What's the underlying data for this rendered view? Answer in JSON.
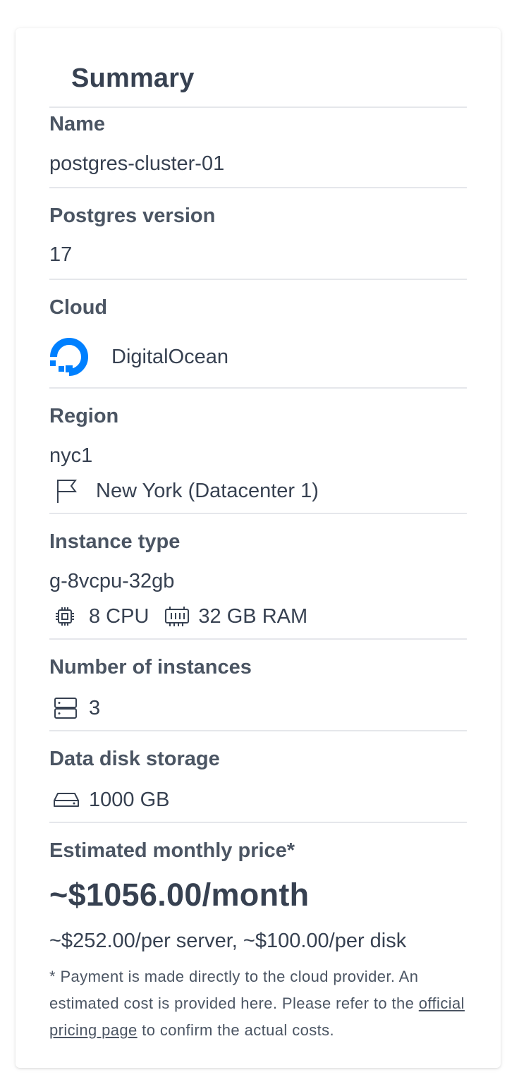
{
  "summary": {
    "title": "Summary",
    "name": {
      "label": "Name",
      "value": "postgres-cluster-01"
    },
    "postgres_version": {
      "label": "Postgres version",
      "value": "17"
    },
    "cloud": {
      "label": "Cloud",
      "value": "DigitalOcean",
      "icon": "digitalocean-logo",
      "brand_color": "#0080FF"
    },
    "region": {
      "label": "Region",
      "code": "nyc1",
      "name": "New York (Datacenter 1)",
      "icon": "flag-icon"
    },
    "instance_type": {
      "label": "Instance type",
      "value": "g-8vcpu-32gb",
      "cpu": "8 CPU",
      "ram": "32 GB RAM",
      "cpu_icon": "cpu-icon",
      "ram_icon": "memory-icon"
    },
    "instances": {
      "label": "Number of instances",
      "value": "3",
      "icon": "server-icon"
    },
    "storage": {
      "label": "Data disk storage",
      "value": "1000 GB",
      "icon": "disk-icon"
    },
    "price": {
      "label": "Estimated monthly price*",
      "total": "~$1056.00/month",
      "breakdown": "~$252.00/per server, ~$100.00/per disk",
      "note_before": "* Payment is made directly to the cloud provider. An estimated cost is provided here. Please refer to the ",
      "link_text": "official pricing page",
      "note_after": " to confirm the actual costs."
    }
  }
}
